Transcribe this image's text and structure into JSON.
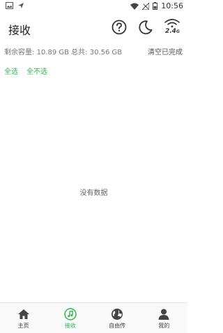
{
  "status_bar": {
    "time": "10:56"
  },
  "header": {
    "title": "接收",
    "band_label": "2.4",
    "band_unit": "G"
  },
  "storage": {
    "remaining_label": "剩余容量:",
    "remaining_value": "10.89 GB",
    "total_label": "总共:",
    "total_value": "30.56 GB",
    "clear_label": "清空已完成"
  },
  "selection": {
    "select_all": "全选",
    "select_none": "全不选"
  },
  "empty_state": "没有数据",
  "tabs": [
    {
      "label": "主页",
      "icon": "home-icon",
      "active": false
    },
    {
      "label": "接收",
      "icon": "music-note-icon",
      "active": true
    },
    {
      "label": "自由传",
      "icon": "globe-icon",
      "active": false
    },
    {
      "label": "我的",
      "icon": "person-icon",
      "active": false
    }
  ],
  "colors": {
    "accent": "#2db84d",
    "text": "#222222",
    "muted": "#777777"
  }
}
